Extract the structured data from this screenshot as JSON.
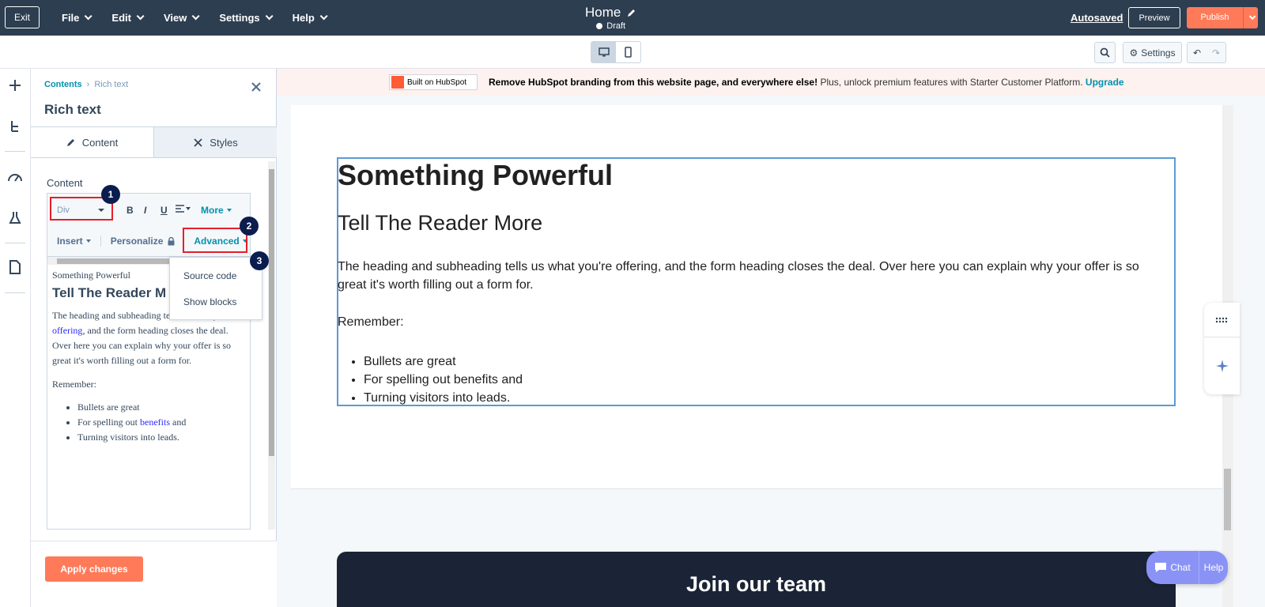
{
  "topbar": {
    "exit_label": "Exit",
    "menu": [
      "File",
      "Edit",
      "View",
      "Settings",
      "Help"
    ],
    "page_title": "Home",
    "status": "Draft",
    "autosaved": "Autosaved",
    "preview_label": "Preview",
    "publish_label": "Publish"
  },
  "toolbar": {
    "settings_label": "Settings"
  },
  "banner": {
    "badge": "Built on HubSpot",
    "bold_text": "Remove HubSpot branding from this website page, and everywhere else!",
    "rest_text": " Plus, unlock premium features with Starter Customer Platform. ",
    "upgrade_link": "Upgrade"
  },
  "panel": {
    "breadcrumb_1": "Contents",
    "breadcrumb_2": "Rich text",
    "title": "Rich text",
    "tab_content": "Content",
    "tab_styles": "Styles",
    "content_label": "Content",
    "format_select": "Div",
    "bold": "B",
    "italic": "I",
    "underline": "U",
    "more": "More",
    "insert": "Insert",
    "personalize": "Personalize",
    "advanced": "Advanced",
    "dropdown_source": "Source code",
    "dropdown_blocks": "Show blocks",
    "apply_label": "Apply changes",
    "badges": [
      "1",
      "2",
      "3"
    ]
  },
  "editor": {
    "heading1": "Something Powerful",
    "heading2": "Tell The Reader M",
    "para_before": "The heading and subheading tells us what you're ",
    "para_link": "offering",
    "para_after": ", and the form heading closes the deal. Over here you can explain why your offer is so great it's worth filling out a form for.",
    "remember": "Remember:",
    "bullet1": "Bullets are great",
    "bullet2_before": "For spelling out ",
    "bullet2_link": "benefits",
    "bullet2_after": " and",
    "bullet3": "Turning visitors into leads."
  },
  "canvas": {
    "heading1": "Something Powerful",
    "heading2": "Tell The Reader More",
    "para_before": "The heading and subheading tells us what you're ",
    "para_link": "offering",
    "para_after": ", and the form heading closes the deal. Over here you can explain why your offer is so great it's worth filling out a form for.",
    "remember": "Remember:",
    "bullet1": "Bullets are great",
    "bullet2_before": "For spelling out ",
    "bullet2_link": "benefits",
    "bullet2_after": " and",
    "bullet3": "Turning visitors into leads.",
    "footer_heading": "Join our team"
  },
  "chat": {
    "chat_label": "Chat",
    "help_label": "Help"
  },
  "colors": {
    "topbar": "#2d3e50",
    "accent_orange": "#ff7a59",
    "highlight_red": "#e61e2b",
    "badge_navy": "#0b1d4e",
    "link": "#0091ae"
  }
}
